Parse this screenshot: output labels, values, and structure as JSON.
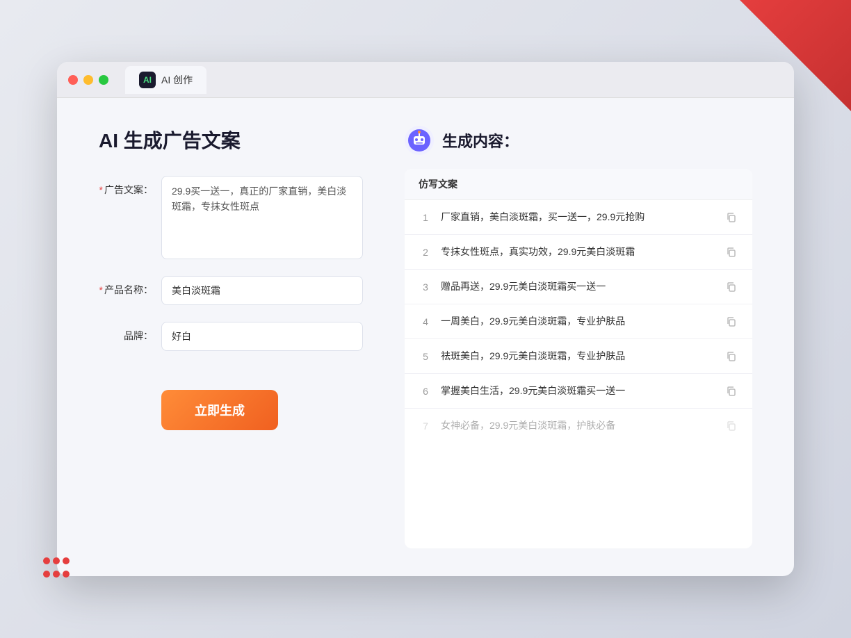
{
  "window": {
    "tab_label": "AI 创作"
  },
  "page": {
    "title": "AI 生成广告文案",
    "generate_button": "立即生成"
  },
  "form": {
    "ad_copy_label": "广告文案：",
    "ad_copy_required": "*",
    "ad_copy_value": "29.9买一送一，真正的厂家直销，美白淡斑霜，专抹女性斑点",
    "product_name_label": "产品名称：",
    "product_name_required": "*",
    "product_name_value": "美白淡斑霜",
    "brand_label": "品牌：",
    "brand_value": "好白"
  },
  "result": {
    "header_title": "生成内容：",
    "table_column": "仿写文案",
    "rows": [
      {
        "number": "1",
        "text": "厂家直销，美白淡斑霜，买一送一，29.9元抢购",
        "dimmed": false
      },
      {
        "number": "2",
        "text": "专抹女性斑点，真实功效，29.9元美白淡斑霜",
        "dimmed": false
      },
      {
        "number": "3",
        "text": "赠品再送，29.9元美白淡斑霜买一送一",
        "dimmed": false
      },
      {
        "number": "4",
        "text": "一周美白，29.9元美白淡斑霜，专业护肤品",
        "dimmed": false
      },
      {
        "number": "5",
        "text": "祛斑美白，29.9元美白淡斑霜，专业护肤品",
        "dimmed": false
      },
      {
        "number": "6",
        "text": "掌握美白生活，29.9元美白淡斑霜买一送一",
        "dimmed": false
      },
      {
        "number": "7",
        "text": "女神必备，29.9元美白淡斑霜，护肤必备",
        "dimmed": true
      }
    ]
  },
  "colors": {
    "accent": "#f06020",
    "required": "#e53e3e",
    "primary": "#1a1a2e"
  }
}
